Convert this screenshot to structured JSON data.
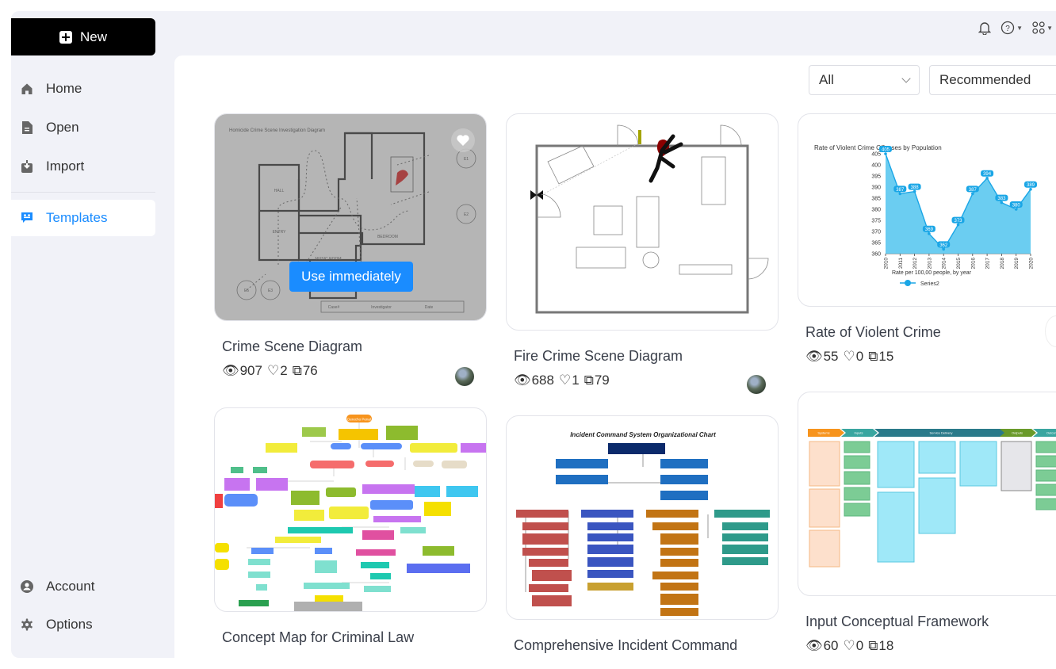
{
  "sidebar": {
    "new_label": "New",
    "items": [
      {
        "label": "Home",
        "icon": "home-icon"
      },
      {
        "label": "Open",
        "icon": "file-icon"
      },
      {
        "label": "Import",
        "icon": "import-icon"
      },
      {
        "label": "Templates",
        "icon": "templates-icon",
        "active": true
      }
    ],
    "bottom_items": [
      {
        "label": "Account",
        "icon": "account-icon"
      },
      {
        "label": "Options",
        "icon": "gear-icon"
      }
    ]
  },
  "topbar": {
    "icons": [
      "bell-icon",
      "help-icon",
      "apps-grid-icon"
    ]
  },
  "filters": {
    "category": "All",
    "sort": "Recommended"
  },
  "accent_color": "#1a8cff",
  "cards": [
    {
      "title": "Crime Scene Diagram",
      "views": "907",
      "likes": "2",
      "copies": "76",
      "hovered": true,
      "use_label": "Use immediately",
      "thumb_title": "Homicide Crime Scene Investigation Diagram",
      "thumb_labels": [
        "HALL",
        "ENTRY",
        "MUSIC ROOM",
        "BEDROOM",
        "E1",
        "E2",
        "E3",
        "E6",
        "Case#",
        "Investigator",
        "Date"
      ]
    },
    {
      "title": "Fire Crime Scene Diagram",
      "views": "688",
      "likes": "1",
      "copies": "79"
    },
    {
      "title": "Rate of Violent Crime",
      "views": "55",
      "likes": "0",
      "copies": "15"
    },
    {
      "title": "Concept Map for Criminal Law",
      "thumb_root": "Derecho Penal"
    },
    {
      "title": "Comprehensive Incident Command",
      "thumb_title": "Incident Command System Organizational Chart"
    },
    {
      "title": "Input Conceptual Framework",
      "views": "60",
      "likes": "0",
      "copies": "18",
      "thumb_stages": [
        "Systems",
        "Inputs",
        "Service Delivery",
        "Outputs",
        "Outcomes"
      ]
    }
  ],
  "chart_data": {
    "type": "area",
    "title": "Rate of Violent Crime Offenses by Population",
    "xlabel": "Rate per 100,00 people, by year",
    "ylabel": "",
    "categories": [
      "2010",
      "2011",
      "2012",
      "2013",
      "2014",
      "2015",
      "2016",
      "2017",
      "2018",
      "2019",
      "2020"
    ],
    "series": [
      {
        "name": "Series2",
        "values": [
          405,
          387,
          388,
          369,
          362,
          373,
          387,
          394,
          383,
          380,
          389
        ]
      }
    ],
    "yticks": [
      360,
      365,
      370,
      375,
      380,
      385,
      390,
      395,
      400,
      405
    ],
    "ylim": [
      360,
      405
    ],
    "legend": "bottom",
    "color": "#5bc8f0"
  }
}
